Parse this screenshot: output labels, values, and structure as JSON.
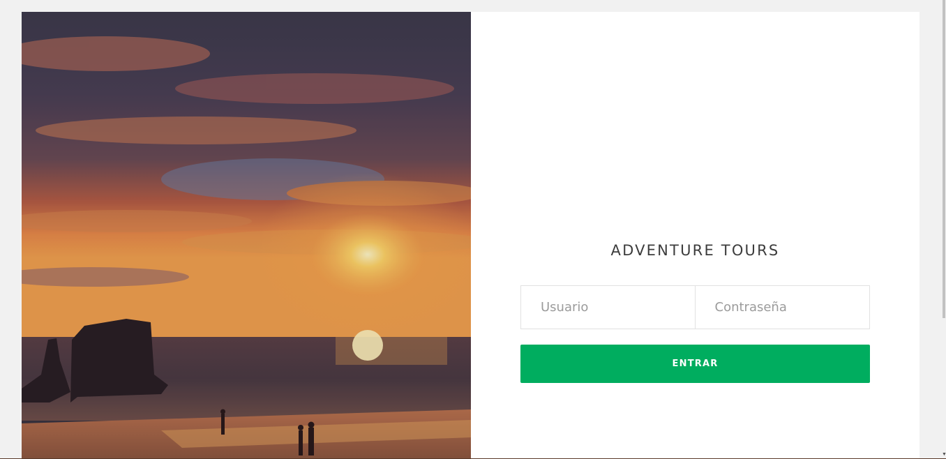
{
  "brand": {
    "title": "ADVENTURE TOURS"
  },
  "login": {
    "username_placeholder": "Usuario",
    "password_placeholder": "Contraseña",
    "submit_label": "ENTRAR"
  },
  "colors": {
    "accent": "#00ad5f",
    "page_background": "#f1f1f1",
    "card_background": "#ffffff"
  },
  "icons": {
    "scroll_down": "chevron-down-icon"
  }
}
